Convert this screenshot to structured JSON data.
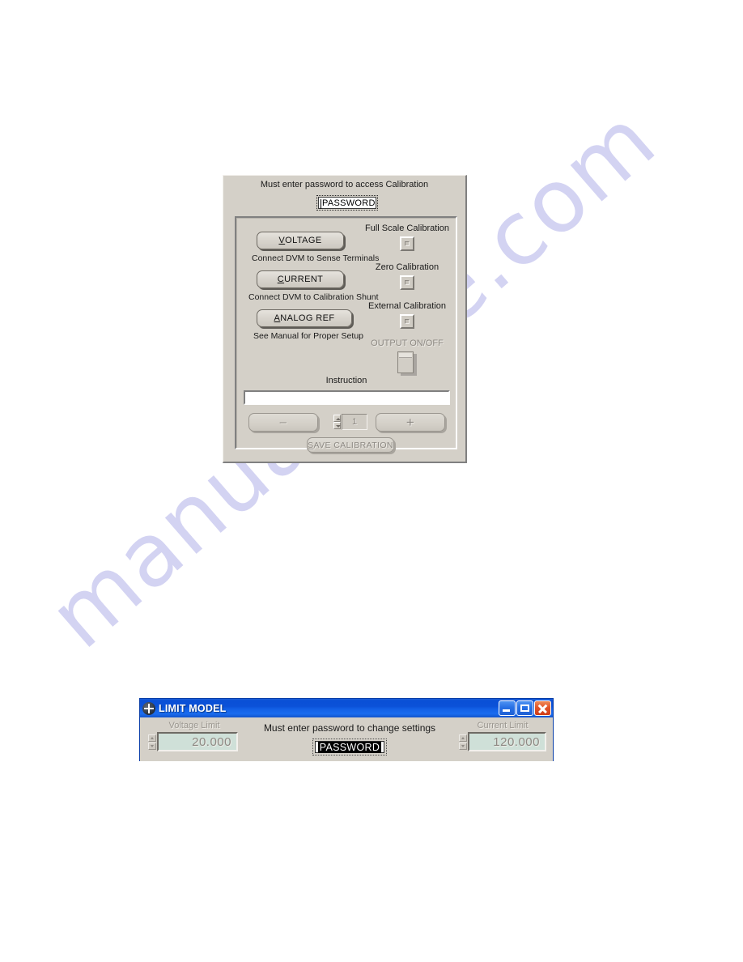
{
  "watermark": {
    "text": "manualslive.com"
  },
  "calibration_dialog": {
    "header_text": "Must enter password to access Calibration",
    "password_field": {
      "name": "PASSWORD",
      "value": "PASSWORD"
    },
    "buttons": [
      {
        "label": "VOLTAGE",
        "accel": "V",
        "rest": "OLTAGE",
        "hint": "Connect DVM to Sense Terminals"
      },
      {
        "label": "CURRENT",
        "accel": "C",
        "rest": "URRENT",
        "hint": "Connect DVM to Calibration Shunt"
      },
      {
        "label": "ANALOG REF",
        "accel": "A",
        "rest": "NALOG REF",
        "hint": "See Manual for Proper Setup"
      }
    ],
    "indicators": [
      {
        "label": "Full Scale Calibration"
      },
      {
        "label": "Zero Calibration"
      },
      {
        "label": "External Calibration"
      }
    ],
    "output_switch": {
      "label": "OUTPUT ON/OFF"
    },
    "instruction": {
      "label": "Instruction",
      "value": ""
    },
    "stepper": {
      "minus_label": "–",
      "plus_label": "+",
      "value": "1"
    },
    "save_button": {
      "accel": "S",
      "rest": "AVE CALIBRATION",
      "label": "SAVE CALIBRATION"
    }
  },
  "limit_window": {
    "title": "LIMIT MODEL",
    "icon": "labview-app-icon",
    "window_buttons": {
      "minimize": "minimize-icon",
      "maximize": "maximize-icon",
      "close": "close-icon"
    },
    "center_text": "Must enter password to change settings",
    "password_field": {
      "value": "PASSWORD"
    },
    "voltage_limit": {
      "label": "Voltage Limit",
      "value": "20.000"
    },
    "current_limit": {
      "label": "Current Limit",
      "value": "120.000"
    },
    "colors": {
      "titlebar": "#0b51d8",
      "numeric_display_bg": "#cfe0d8",
      "panel": "#d4d0c8"
    }
  }
}
